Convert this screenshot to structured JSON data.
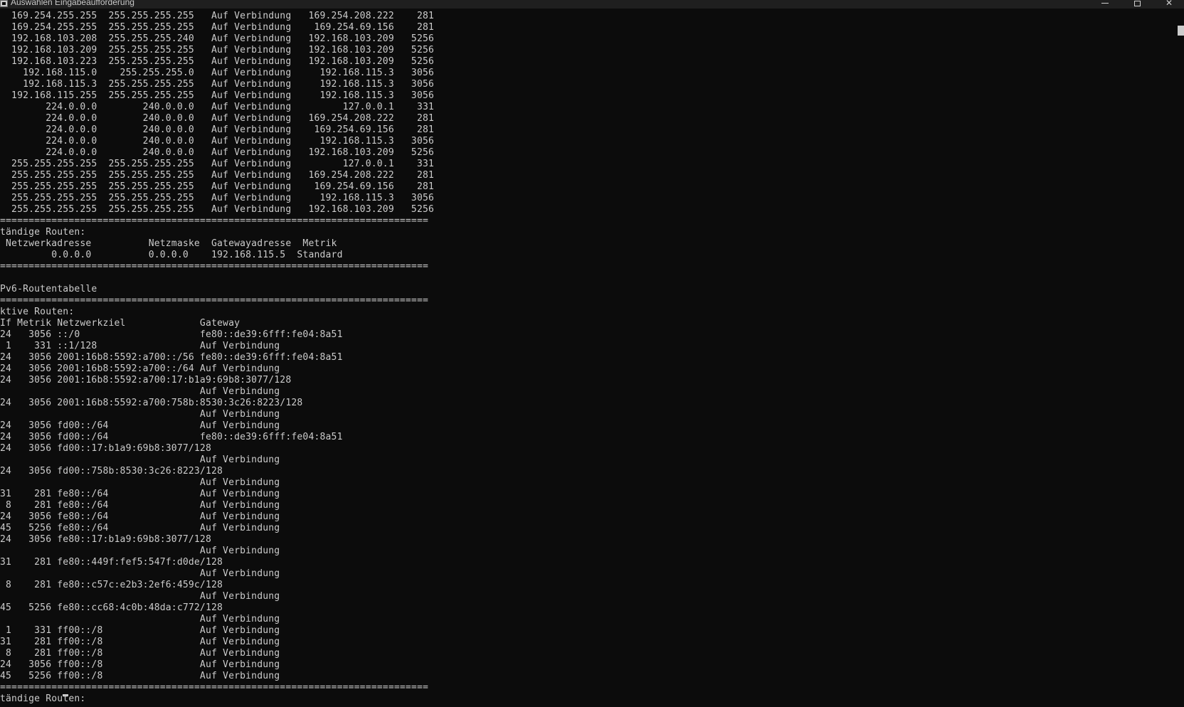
{
  "window": {
    "title": "Auswählen Eingabeaufforderung"
  },
  "console": {
    "lines": [
      "  169.254.255.255  255.255.255.255   Auf Verbindung   169.254.208.222    281",
      "  169.254.255.255  255.255.255.255   Auf Verbindung    169.254.69.156    281",
      "  192.168.103.208  255.255.255.240   Auf Verbindung   192.168.103.209   5256",
      "  192.168.103.209  255.255.255.255   Auf Verbindung   192.168.103.209   5256",
      "  192.168.103.223  255.255.255.255   Auf Verbindung   192.168.103.209   5256",
      "    192.168.115.0    255.255.255.0   Auf Verbindung     192.168.115.3   3056",
      "    192.168.115.3  255.255.255.255   Auf Verbindung     192.168.115.3   3056",
      "  192.168.115.255  255.255.255.255   Auf Verbindung     192.168.115.3   3056",
      "        224.0.0.0        240.0.0.0   Auf Verbindung         127.0.0.1    331",
      "        224.0.0.0        240.0.0.0   Auf Verbindung   169.254.208.222    281",
      "        224.0.0.0        240.0.0.0   Auf Verbindung    169.254.69.156    281",
      "        224.0.0.0        240.0.0.0   Auf Verbindung     192.168.115.3   3056",
      "        224.0.0.0        240.0.0.0   Auf Verbindung   192.168.103.209   5256",
      "  255.255.255.255  255.255.255.255   Auf Verbindung         127.0.0.1    331",
      "  255.255.255.255  255.255.255.255   Auf Verbindung   169.254.208.222    281",
      "  255.255.255.255  255.255.255.255   Auf Verbindung    169.254.69.156    281",
      "  255.255.255.255  255.255.255.255   Auf Verbindung     192.168.115.3   3056",
      "  255.255.255.255  255.255.255.255   Auf Verbindung   192.168.103.209   5256",
      "===========================================================================",
      "tändige Routen:",
      " Netzwerkadresse          Netzmaske  Gatewayadresse  Metrik",
      "         0.0.0.0          0.0.0.0    192.168.115.5  Standard",
      "===========================================================================",
      "",
      "Pv6-Routentabelle",
      "===========================================================================",
      "ktive Routen:",
      "If Metrik Netzwerkziel             Gateway",
      "24   3056 ::/0                     fe80::de39:6fff:fe04:8a51",
      " 1    331 ::1/128                  Auf Verbindung",
      "24   3056 2001:16b8:5592:a700::/56 fe80::de39:6fff:fe04:8a51",
      "24   3056 2001:16b8:5592:a700::/64 Auf Verbindung",
      "24   3056 2001:16b8:5592:a700:17:b1a9:69b8:3077/128",
      "                                   Auf Verbindung",
      "24   3056 2001:16b8:5592:a700:758b:8530:3c26:8223/128",
      "                                   Auf Verbindung",
      "24   3056 fd00::/64                Auf Verbindung",
      "24   3056 fd00::/64                fe80::de39:6fff:fe04:8a51",
      "24   3056 fd00::17:b1a9:69b8:3077/128",
      "                                   Auf Verbindung",
      "24   3056 fd00::758b:8530:3c26:8223/128",
      "                                   Auf Verbindung",
      "31    281 fe80::/64                Auf Verbindung",
      " 8    281 fe80::/64                Auf Verbindung",
      "24   3056 fe80::/64                Auf Verbindung",
      "45   5256 fe80::/64                Auf Verbindung",
      "24   3056 fe80::17:b1a9:69b8:3077/128",
      "                                   Auf Verbindung",
      "31    281 fe80::449f:fef5:547f:d0de/128",
      "                                   Auf Verbindung",
      " 8    281 fe80::c57c:e2b3:2ef6:459c/128",
      "                                   Auf Verbindung",
      "45   5256 fe80::cc68:4c0b:48da:c772/128",
      "                                   Auf Verbindung",
      " 1    331 ff00::/8                 Auf Verbindung",
      "31    281 ff00::/8                 Auf Verbindung",
      " 8    281 ff00::/8                 Auf Verbindung",
      "24   3056 ff00::/8                 Auf Verbindung",
      "45   5256 ff00::/8                 Auf Verbindung",
      "===========================================================================",
      "tändige Routen:"
    ]
  },
  "colors": {
    "background": "#0c0c0c",
    "text": "#cccccc",
    "titlebar": "#1f1f1f"
  },
  "icons": [
    "console-app-icon",
    "minimize-icon",
    "maximize-icon",
    "close-icon"
  ]
}
